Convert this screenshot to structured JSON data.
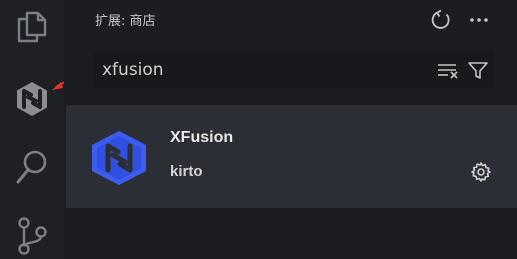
{
  "activity_bar": {
    "icons": [
      "files-icon",
      "xfusion-extension-icon",
      "search-icon",
      "source-control-icon"
    ]
  },
  "sidebar": {
    "title": "扩展: 商店",
    "actions": [
      "refresh-icon",
      "more-actions-icon"
    ]
  },
  "search": {
    "value": "xfusion",
    "buttons": [
      "clear-results-icon",
      "filter-icon"
    ]
  },
  "extension": {
    "name": "XFusion",
    "author": "kirto",
    "logo_color": "#3d5cf0"
  },
  "colors": {
    "annotation_arrow": "#e5322d"
  }
}
